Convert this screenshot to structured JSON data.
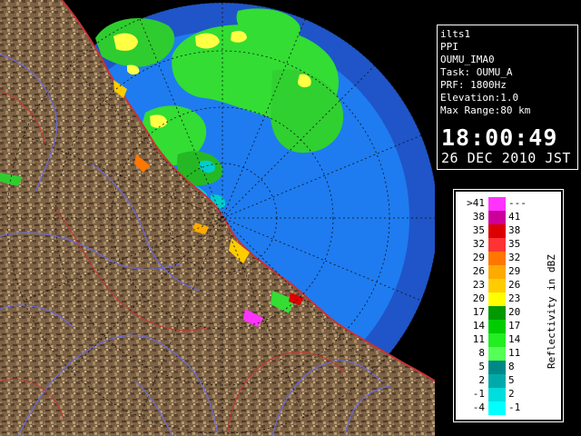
{
  "info": {
    "station": "ilts1",
    "product": "PPI",
    "site": "OUMU_IMA0",
    "task": "Task: OUMU_A",
    "prf": "PRF: 1800Hz",
    "elevation": "Elevation:1.0",
    "max_range": "Max Range:80 km",
    "time": "18:00:49",
    "date": "26 DEC 2010 JST"
  },
  "legend": {
    "title": "Reflectivity in dBZ",
    "rows": [
      {
        "low": ">41",
        "high": "---",
        "color": "#ff33ff"
      },
      {
        "low": "38",
        "high": "41",
        "color": "#cc0099"
      },
      {
        "low": "35",
        "high": "38",
        "color": "#dd0000"
      },
      {
        "low": "32",
        "high": "35",
        "color": "#ff3333"
      },
      {
        "low": "29",
        "high": "32",
        "color": "#ff7700"
      },
      {
        "low": "26",
        "high": "29",
        "color": "#ffaa00"
      },
      {
        "low": "23",
        "high": "26",
        "color": "#ffcc00"
      },
      {
        "low": "20",
        "high": "23",
        "color": "#ffff00"
      },
      {
        "low": "17",
        "high": "20",
        "color": "#009900"
      },
      {
        "low": "14",
        "high": "17",
        "color": "#00cc00"
      },
      {
        "low": "11",
        "high": "14",
        "color": "#22ee22"
      },
      {
        "low": "8",
        "high": "11",
        "color": "#55ff55"
      },
      {
        "low": "5",
        "high": "8",
        "color": "#008888"
      },
      {
        "low": "2",
        "high": "5",
        "color": "#00aaaa"
      },
      {
        "low": "-1",
        "high": "2",
        "color": "#00dddd"
      },
      {
        "low": "-4",
        "high": "-1",
        "color": "#00ffff"
      }
    ]
  },
  "colors": {
    "background": "#000000",
    "ocean_outer": "#1f55c8",
    "ocean_inner": "#1e7cf0",
    "land": "#7a5f42",
    "rivers": "#6a6ad8",
    "coast_red": "#c83232"
  }
}
